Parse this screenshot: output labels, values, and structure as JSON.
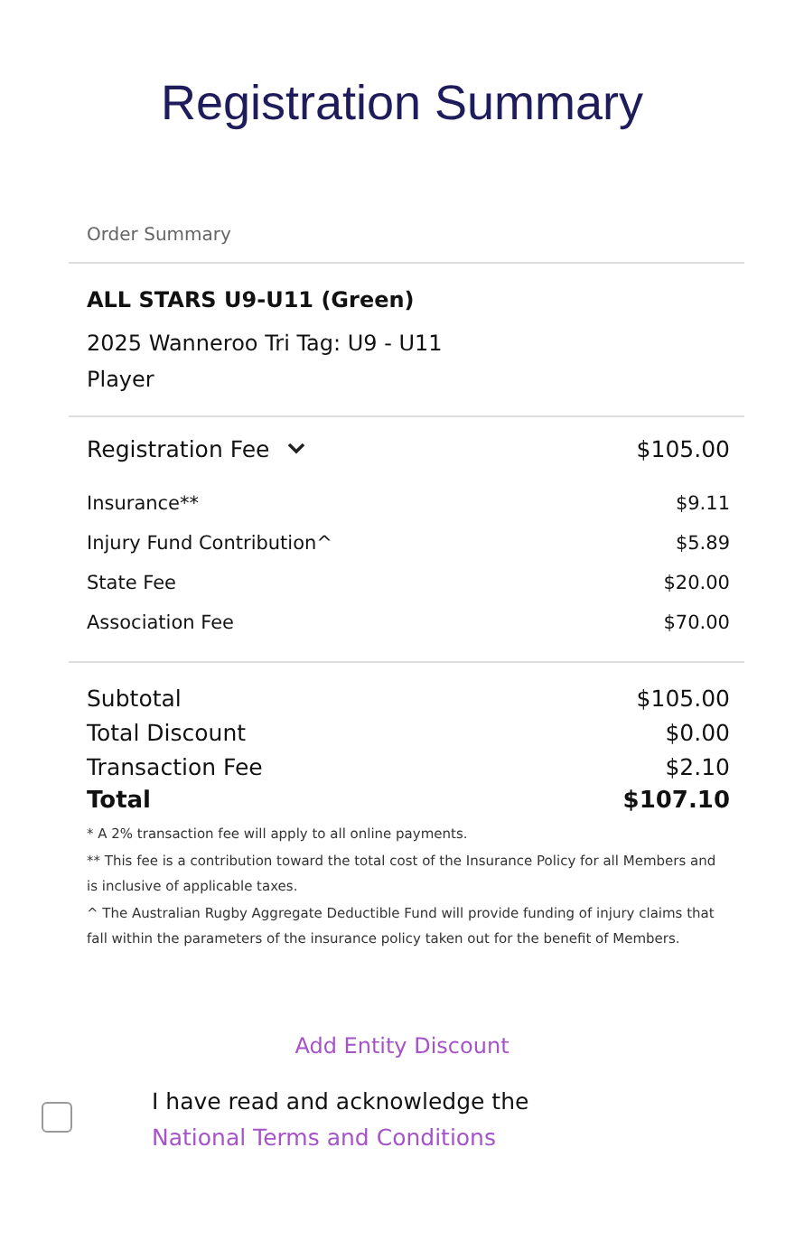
{
  "title": "Registration Summary",
  "order_summary": {
    "heading": "Order Summary",
    "team": "ALL STARS U9-U11 (Green)",
    "competition": "2025 Wanneroo Tri Tag: U9 - U11",
    "role": "Player",
    "fee": {
      "label": "Registration Fee",
      "amount": "$105.00",
      "expanded": true
    },
    "breakdown": [
      {
        "label": "Insurance**",
        "amount": "$9.11"
      },
      {
        "label": "Injury Fund Contribution^",
        "amount": "$5.89"
      },
      {
        "label": "State Fee",
        "amount": "$20.00"
      },
      {
        "label": "Association Fee",
        "amount": "$70.00"
      }
    ],
    "totals": [
      {
        "label": "Subtotal",
        "amount": "$105.00"
      },
      {
        "label": "Total Discount",
        "amount": "$0.00"
      },
      {
        "label": "Transaction Fee",
        "amount": "$2.10"
      }
    ],
    "total": {
      "label": "Total",
      "amount": "$107.10"
    },
    "notes": [
      "* A 2% transaction fee will apply to all online payments.",
      "** This fee is a contribution toward the total cost of the Insurance Policy for all Members and is inclusive of applicable taxes.",
      "^ The Australian Rugby Aggregate Deductible Fund will provide funding of injury claims that fall within the parameters of the insurance policy taken out for the benefit of Members."
    ]
  },
  "discount_link": "Add Entity Discount",
  "terms": {
    "checked": false,
    "text": "I have read and acknowledge the",
    "link": "National Terms and Conditions"
  }
}
